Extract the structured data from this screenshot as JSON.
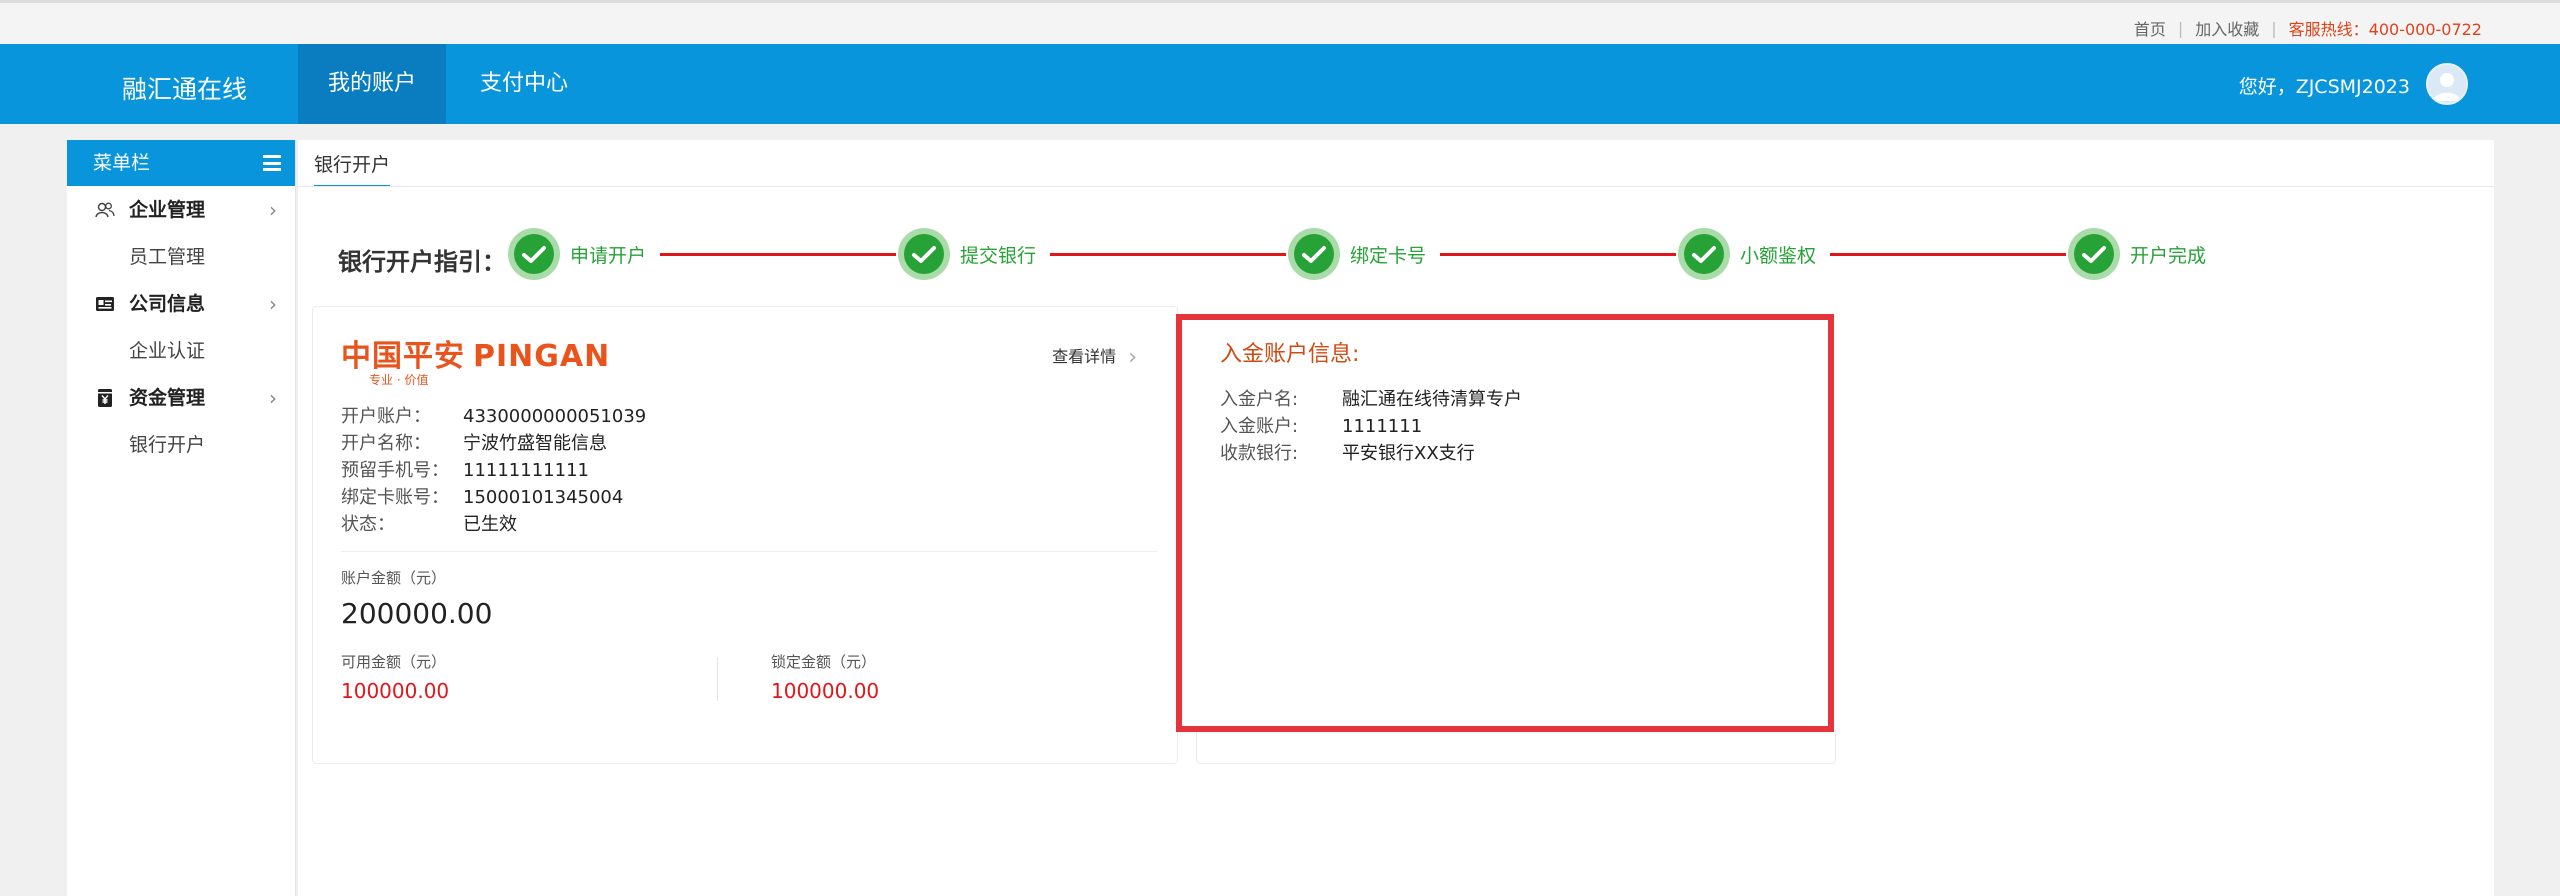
{
  "topbar": {
    "home": "首页",
    "favorite": "加入收藏",
    "hotline": "客服热线：400-000-0722"
  },
  "nav": {
    "brand": "融汇通在线",
    "tabs": [
      {
        "label": "我的账户",
        "active": true
      },
      {
        "label": "支付中心",
        "active": false
      }
    ],
    "greeting": "您好，ZJCSMJ2023"
  },
  "sidebar": {
    "title": "菜单栏",
    "groups": [
      {
        "label": "企业管理",
        "icon": "users-icon",
        "items": [
          "员工管理"
        ]
      },
      {
        "label": "公司信息",
        "icon": "id-card-icon",
        "items": [
          "企业认证"
        ]
      },
      {
        "label": "资金管理",
        "icon": "money-icon",
        "items": [
          "银行开户"
        ]
      }
    ]
  },
  "content": {
    "tab": "银行开户",
    "guide_title": "银行开户指引：",
    "steps": [
      "申请开户",
      "提交银行",
      "绑定卡号",
      "小额鉴权",
      "开户完成"
    ],
    "card": {
      "logo_cn": "中国平安",
      "logo_en": "PINGAN",
      "logo_slogan": "专业 · 价值",
      "detail_link": "查看详情",
      "fields": [
        {
          "label": "开户账户：",
          "value": "4330000000051039"
        },
        {
          "label": "开户名称：",
          "value": "宁波竹盛智能信息"
        },
        {
          "label": "预留手机号：",
          "value": "11111111111"
        },
        {
          "label": "绑定卡账号：",
          "value": "15000101345004"
        },
        {
          "label": "状态：",
          "value": "已生效"
        }
      ],
      "balance_label": "账户金额（元）",
      "balance": "200000.00",
      "available_label": "可用金额（元）",
      "available": "100000.00",
      "locked_label": "锁定金额（元）",
      "locked": "100000.00"
    },
    "deposit": {
      "title": "入金账户信息:",
      "fields": [
        {
          "label": "入金户名:",
          "value": "融汇通在线待清算专户"
        },
        {
          "label": "入金账户:",
          "value": "1111111"
        },
        {
          "label": "收款银行:",
          "value": "平安银行XX支行"
        }
      ]
    }
  },
  "colors": {
    "primary": "#0895dc",
    "success": "#27a236",
    "danger": "#e0161a",
    "brand_orange": "#e8541c"
  }
}
